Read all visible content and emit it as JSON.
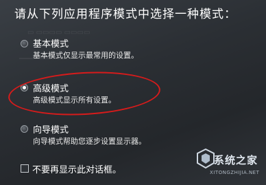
{
  "dialog": {
    "prompt": "请从下列应用程序模式中选择一种模式："
  },
  "options": [
    {
      "title": "基本模式",
      "description": "基本模式仅显示最常用的设置。",
      "selected": false
    },
    {
      "title": "高级模式",
      "description": "高级模式显示所有设置。",
      "selected": true
    },
    {
      "title": "向导模式",
      "description": "向导模式帮助您逐步设置显示器。",
      "selected": false
    }
  ],
  "checkbox": {
    "label": "不要再显示此对话框。",
    "checked": false
  },
  "highlight": {
    "color": "#d81b1b"
  },
  "watermark": {
    "name": "系统之家",
    "url": "XITONGZHIJIA.NET"
  }
}
